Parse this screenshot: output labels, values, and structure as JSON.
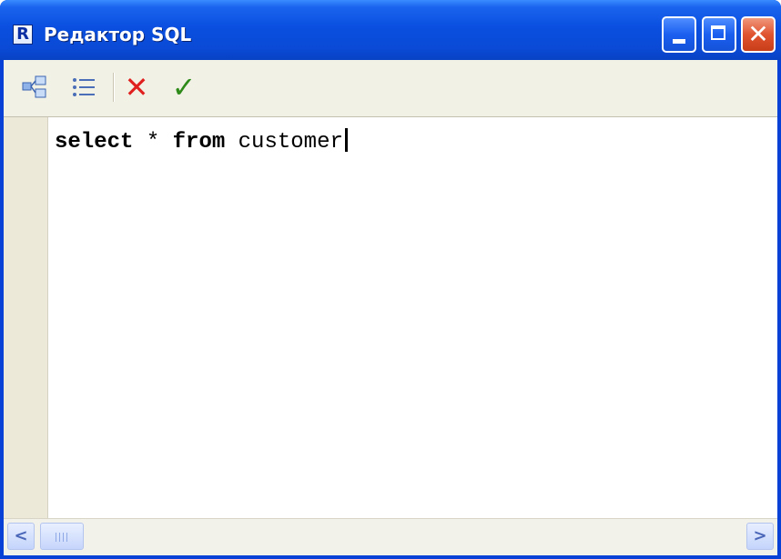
{
  "window": {
    "title": "Редактор SQL",
    "app_icon_glyph": "R",
    "app_icon": "fastreport-icon",
    "title_bar_color": "#0a4fe0",
    "close_button_color": "#e05430"
  },
  "toolbar": {
    "items": [
      {
        "icon": "query-builder-icon",
        "glyph": "⊞"
      },
      {
        "icon": "list-icon",
        "glyph": "☰"
      },
      {
        "icon": "cancel-icon",
        "glyph": "✕",
        "color": "#e0201e"
      },
      {
        "icon": "ok-icon",
        "glyph": "✓",
        "color": "#2e8b1a"
      }
    ]
  },
  "editor": {
    "keyword_select": "select",
    "star": " * ",
    "keyword_from": "from",
    "rest": " customer"
  },
  "scrollbar": {
    "left_glyph": "<",
    "right_glyph": ">"
  }
}
